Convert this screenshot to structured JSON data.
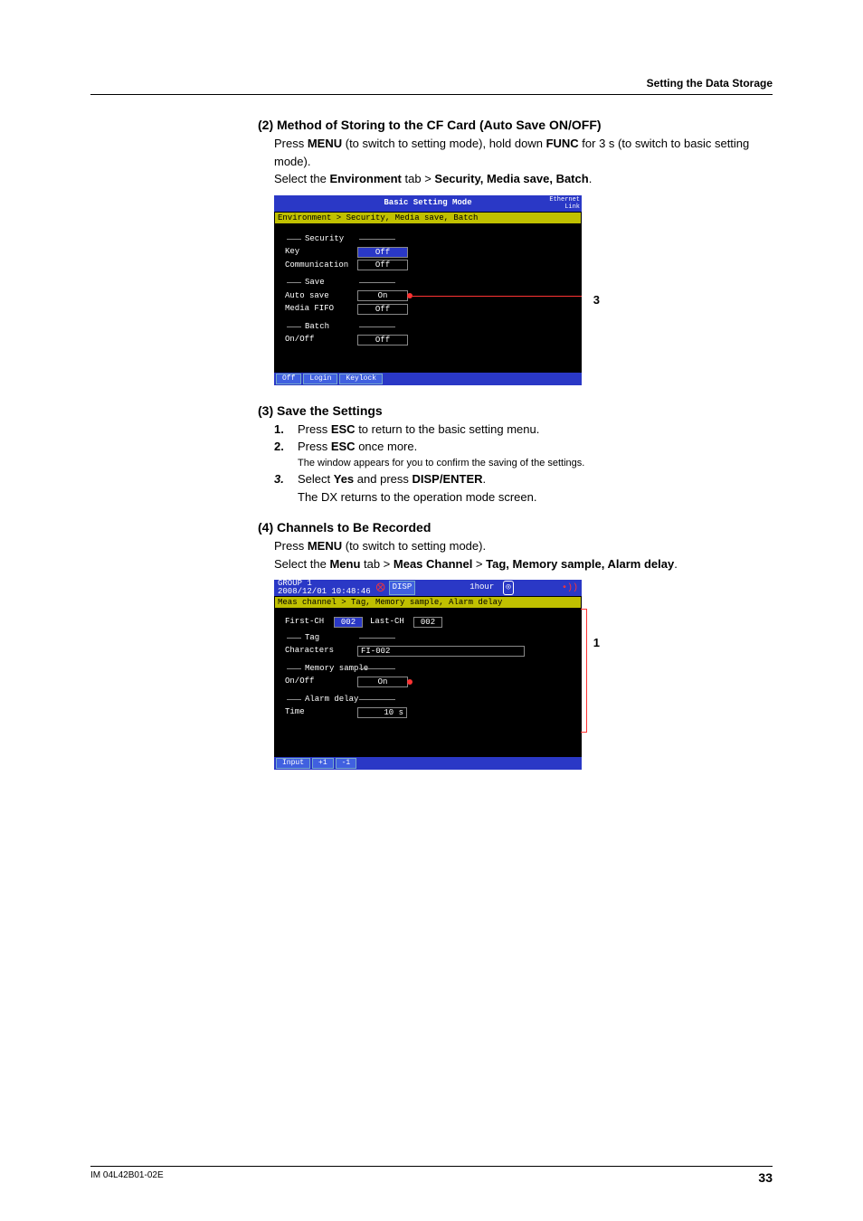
{
  "header": {
    "section_title": "Setting the Data Storage"
  },
  "s2": {
    "title": "(2) Method of Storing to the CF Card (Auto Save ON/OFF)",
    "p1a": "Press ",
    "p1b": "MENU",
    "p1c": " (to switch to setting mode), hold down ",
    "p1d": "FUNC",
    "p1e": " for 3 s (to switch to basic setting mode).",
    "p2a": "Select the ",
    "p2b": "Environment",
    "p2c": " tab > ",
    "p2d": "Security, Media save, Batch",
    "p2e": "."
  },
  "shot1": {
    "title": "Basic Setting Mode",
    "ethernet": "Ethernet\nLink",
    "breadcrumb": "Environment > Security, Media save, Batch",
    "grp1": "Security",
    "r1": {
      "lbl": "Key",
      "val": "Off"
    },
    "r2": {
      "lbl": "Communication",
      "val": "Off"
    },
    "grp2": "Save",
    "r3": {
      "lbl": "Auto save",
      "val": "On"
    },
    "r4": {
      "lbl": "Media FIFO",
      "val": "Off"
    },
    "grp3": "Batch",
    "r5": {
      "lbl": "On/Off",
      "val": "Off"
    },
    "footer": {
      "b1": "Off",
      "b2": "Login",
      "b3": "Keylock"
    },
    "callout": "3"
  },
  "s3": {
    "title": "(3) Save the Settings",
    "i1n": "1.",
    "i1a": "Press ",
    "i1b": "ESC",
    "i1c": " to return to the basic setting menu.",
    "i2n": "2.",
    "i2a": "Press ",
    "i2b": "ESC",
    "i2c": " once more.",
    "i2sub": "The window appears for you to confirm the saving of the settings.",
    "i3n": "3.",
    "i3a": "Select ",
    "i3b": "Yes",
    "i3c": " and press ",
    "i3d": "DISP/ENTER",
    "i3e": ".",
    "i3note": "The DX returns to the operation mode screen."
  },
  "s4": {
    "title": "(4) Channels to Be Recorded",
    "p1a": "Press ",
    "p1b": "MENU",
    "p1c": " (to switch to setting mode).",
    "p2a": "Select the ",
    "p2b": "Menu",
    "p2c": " tab > ",
    "p2d": "Meas Channel",
    "p2e": " > ",
    "p2f": "Tag, Memory sample, Alarm delay",
    "p2g": "."
  },
  "shot2": {
    "group": "GROUP 1",
    "datetime": "2008/12/01 10:48:46",
    "disp": "DISP",
    "interval": "1hour",
    "breadcrumb": "Meas channel > Tag, Memory sample, Alarm delay",
    "r0a": {
      "lbl": "First-CH",
      "val": "002"
    },
    "r0b": {
      "lbl": "Last-CH",
      "val": "002"
    },
    "grp1": "Tag",
    "r1": {
      "lbl": "Characters",
      "val": "FI-002"
    },
    "grp2": "Memory sample",
    "r2": {
      "lbl": "On/Off",
      "val": "On"
    },
    "grp3": "Alarm delay",
    "r3": {
      "lbl": "Time",
      "val": "10 s"
    },
    "footer": {
      "b1": "Input",
      "b2": "+1",
      "b3": "-1"
    },
    "callout": "1"
  },
  "footer": {
    "doc": "IM 04L42B01-02E",
    "page": "33"
  }
}
